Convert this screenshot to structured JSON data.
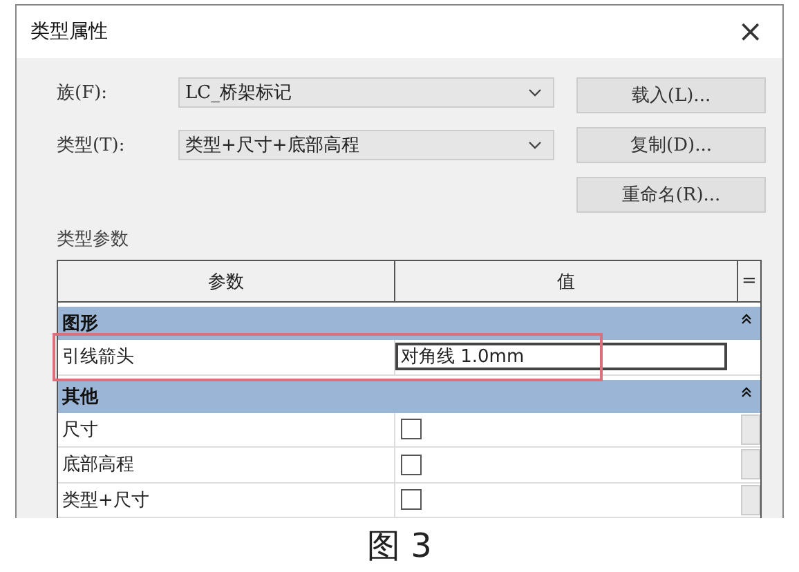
{
  "window": {
    "title": "类型属性",
    "close": "×"
  },
  "fields": [
    {
      "label": "族(F):",
      "value": "LC_桥架标记"
    },
    {
      "label": "类型(T):",
      "value": "类型+尺寸+底部高程"
    }
  ],
  "buttons": [
    "载入(L)...",
    "复制(D)...",
    "重命名(R)..."
  ],
  "section_label": "类型参数",
  "table": {
    "columns": [
      "参数",
      "值",
      "="
    ],
    "groups": [
      {
        "name": "图形",
        "expanded": true,
        "rows": [
          {
            "kind": "text",
            "name": "引线箭头",
            "value": "对角线 1.0mm",
            "highlighted": true
          }
        ]
      },
      {
        "name": "其他",
        "expanded": true,
        "rows": [
          {
            "kind": "checkbox",
            "name": "尺寸",
            "checked": false,
            "highlighted": false
          },
          {
            "kind": "checkbox",
            "name": "底部高程",
            "checked": false,
            "highlighted": false
          },
          {
            "kind": "checkbox",
            "name": "类型+尺寸",
            "checked": false,
            "highlighted": false
          }
        ]
      }
    ]
  },
  "caption": "图 3"
}
